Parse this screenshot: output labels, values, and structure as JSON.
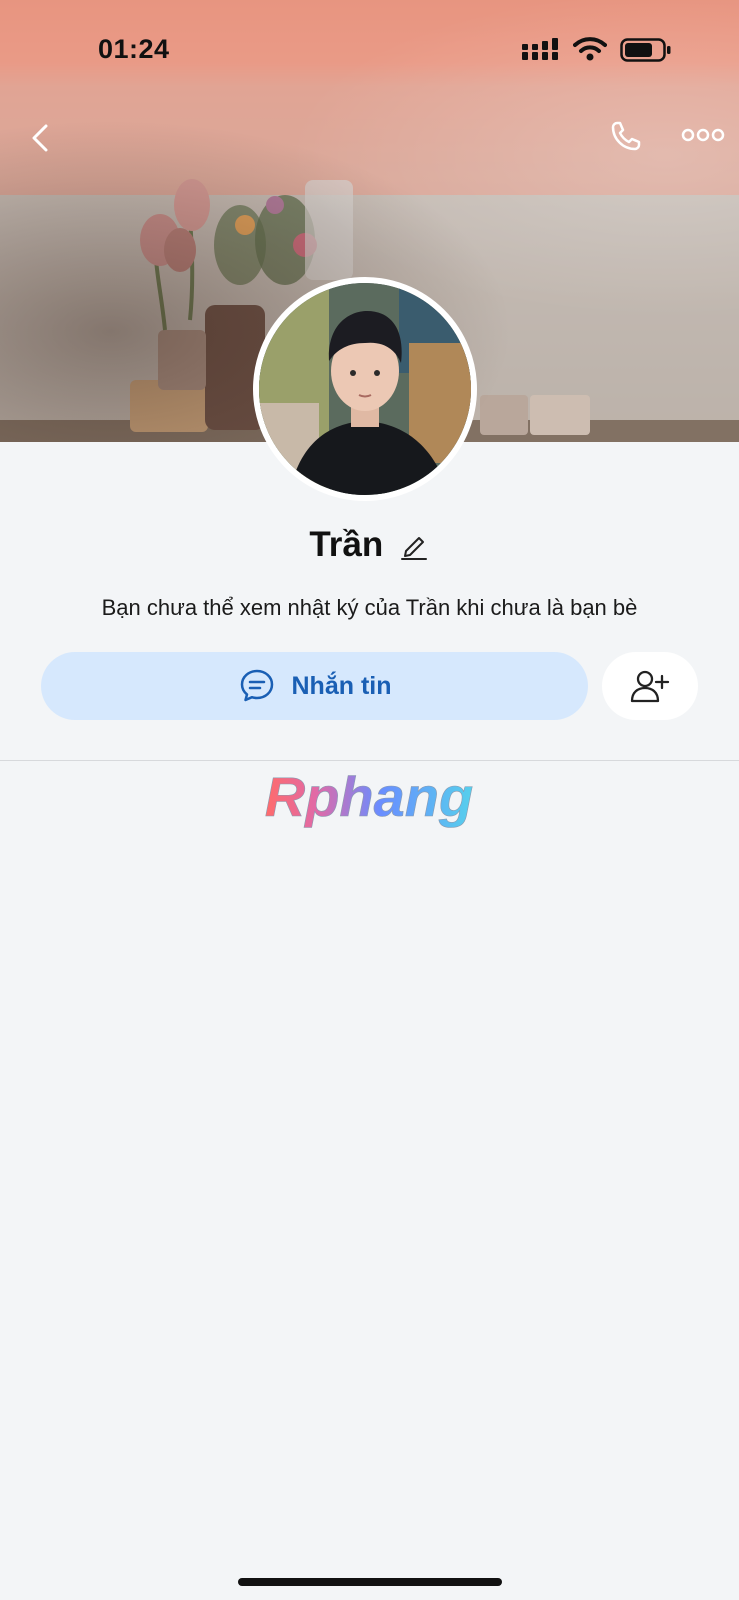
{
  "status_bar": {
    "time": "01:24"
  },
  "profile": {
    "name": "Trần",
    "notice": "Bạn chưa thể xem nhật ký của Trần khi chưa là bạn bè"
  },
  "actions": {
    "message_label": "Nhắn tin"
  },
  "watermark": {
    "text": "Rphang"
  },
  "icons": {
    "back": "chevron-left-icon",
    "call": "phone-icon",
    "more": "more-dots-icon",
    "edit": "pencil-icon",
    "message": "chat-bubble-icon",
    "add_friend": "add-friend-icon"
  },
  "colors": {
    "accent": "#1a5fb4",
    "button_bg": "#d6e8fd",
    "background": "#f3f5f7"
  }
}
